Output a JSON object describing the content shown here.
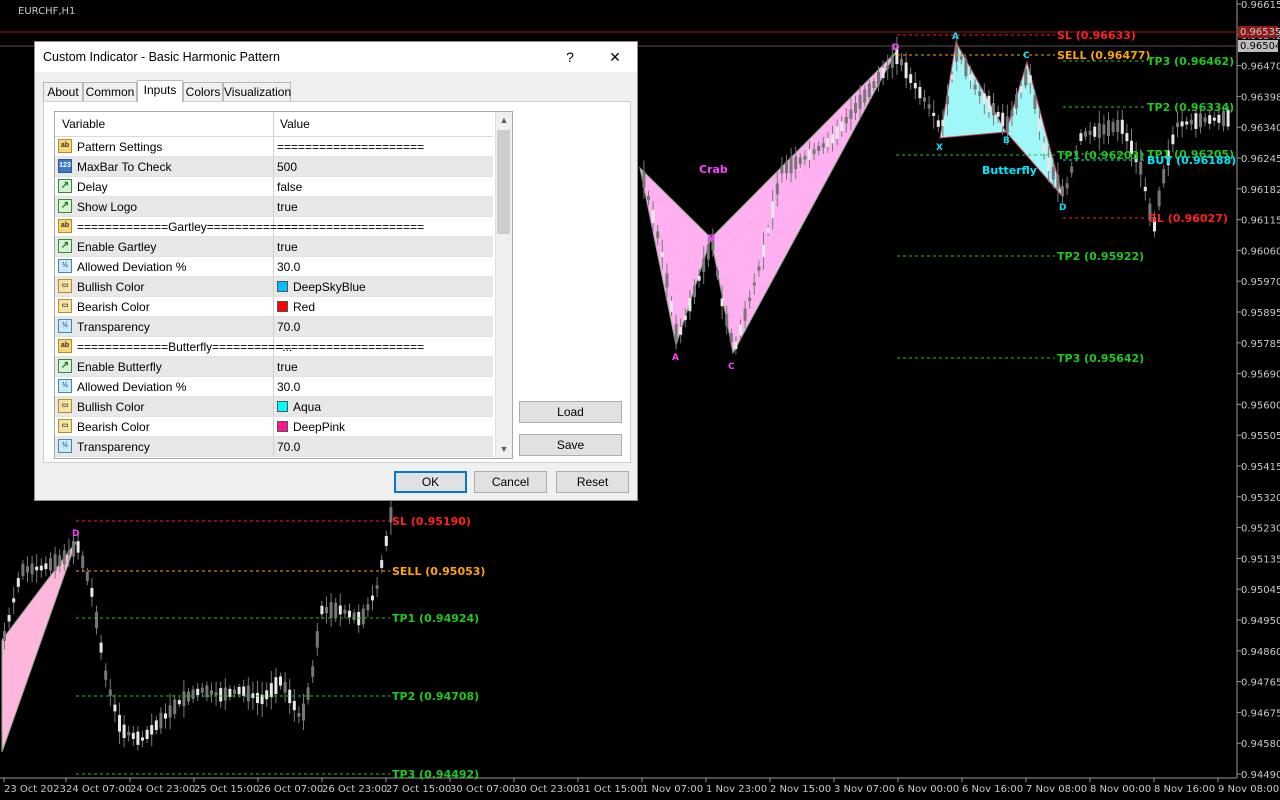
{
  "chart": {
    "symbol": "EURCHF,H1",
    "price_axis": [
      "0.96615",
      "0.96542",
      "0.96470",
      "0.96398",
      "0.96340",
      "0.96245",
      "0.96182",
      "0.96115",
      "0.96060",
      "0.95970",
      "0.95895",
      "0.95785",
      "0.95690",
      "0.95600",
      "0.95505",
      "0.95415",
      "0.95320",
      "0.95230",
      "0.95135",
      "0.95045",
      "0.94950",
      "0.94860",
      "0.94765",
      "0.94675",
      "0.94580",
      "0.94490"
    ],
    "current_prices": [
      "0.96535",
      "0.96504"
    ],
    "time_axis": [
      "23 Oct 2023",
      "24 Oct 07:00",
      "24 Oct 23:00",
      "25 Oct 15:00",
      "26 Oct 07:00",
      "26 Oct 23:00",
      "27 Oct 15:00",
      "30 Oct 07:00",
      "30 Oct 23:00",
      "31 Oct 15:00",
      "1 Nov 07:00",
      "1 Nov 23:00",
      "2 Nov 15:00",
      "3 Nov 07:00",
      "6 Nov 00:00",
      "6 Nov 16:00",
      "7 Nov 08:00",
      "8 Nov 00:00",
      "8 Nov 16:00",
      "9 Nov 08:00"
    ],
    "colors": {
      "sl": "#ff2020",
      "sell": "#ffa500",
      "tp": "#1ec81e",
      "buy": "#00e5ff",
      "crab": "#ffb0f0",
      "butterfly": "#a0f7f7",
      "gartley_pink": "#ffb6dc"
    },
    "levels": [
      {
        "label": "SL (0.96633)",
        "type": "sl"
      },
      {
        "label": "SELL (0.96477)",
        "type": "sell"
      },
      {
        "label": "TP3 (0.96462)",
        "type": "tp"
      },
      {
        "label": "TP2 (0.96334)",
        "type": "tp"
      },
      {
        "label": "TP1 (0.96205)",
        "type": "tp"
      },
      {
        "label": "TP1 (0.96203)",
        "type": "tp"
      },
      {
        "label": "BUY (0.96188)",
        "type": "buy"
      },
      {
        "label": "SL (0.96027)",
        "type": "sl"
      },
      {
        "label": "TP2 (0.95922)",
        "type": "tp"
      },
      {
        "label": "TP3 (0.95642)",
        "type": "tp"
      },
      {
        "label": "SL (0.95190)",
        "type": "sl"
      },
      {
        "label": "SELL (0.95053)",
        "type": "sell"
      },
      {
        "label": "TP1 (0.94924)",
        "type": "tp"
      },
      {
        "label": "TP2 (0.94708)",
        "type": "tp"
      },
      {
        "label": "TP3 (0.94492)",
        "type": "tp"
      }
    ],
    "pattern_names": [
      "Crab",
      "Butterfly"
    ],
    "point_labels": {
      "a": "A",
      "b": "B",
      "c": "C",
      "d": "D",
      "x": "X"
    }
  },
  "dialog": {
    "title": "Custom Indicator - Basic Harmonic Pattern",
    "help": "?",
    "close": "✕",
    "tabs": [
      "About",
      "Common",
      "Inputs",
      "Colors",
      "Visualization"
    ],
    "active_tab": "Inputs",
    "columns": [
      "Variable",
      "Value"
    ],
    "rows": [
      {
        "icon": "ab",
        "name": "Pattern Settings",
        "value": "====================="
      },
      {
        "icon": "123",
        "name": "MaxBar To Check",
        "value": "500"
      },
      {
        "icon": "bool",
        "name": "Delay",
        "value": "false"
      },
      {
        "icon": "bool",
        "name": "Show Logo",
        "value": "true"
      },
      {
        "icon": "ab",
        "name": "=============Gartley=============",
        "value": "====================="
      },
      {
        "icon": "bool",
        "name": "Enable Gartley",
        "value": "true"
      },
      {
        "icon": "dbl",
        "name": "Allowed Deviation %",
        "value": "30.0"
      },
      {
        "icon": "col",
        "name": "Bullish Color",
        "value": "DeepSkyBlue",
        "swatch": "#00bfff"
      },
      {
        "icon": "col",
        "name": "Bearish Color",
        "value": "Red",
        "swatch": "#ff0000"
      },
      {
        "icon": "dbl",
        "name": "Transparency",
        "value": "70.0"
      },
      {
        "icon": "ab",
        "name": "=============Butterfly==========...",
        "value": "====================="
      },
      {
        "icon": "bool",
        "name": "Enable Butterfly",
        "value": "true"
      },
      {
        "icon": "dbl",
        "name": "Allowed Deviation %",
        "value": "30.0"
      },
      {
        "icon": "col",
        "name": "Bullish Color",
        "value": "Aqua",
        "swatch": "#00ffff"
      },
      {
        "icon": "col",
        "name": "Bearish Color",
        "value": "DeepPink",
        "swatch": "#ff1493"
      },
      {
        "icon": "dbl",
        "name": "Transparency",
        "value": "70.0"
      }
    ],
    "icon_text": {
      "ab": "ab",
      "123": "123",
      "bool": "↗",
      "dbl": "½",
      "col": "▭"
    },
    "buttons": {
      "load": "Load",
      "save": "Save",
      "ok": "OK",
      "cancel": "Cancel",
      "reset": "Reset"
    }
  }
}
